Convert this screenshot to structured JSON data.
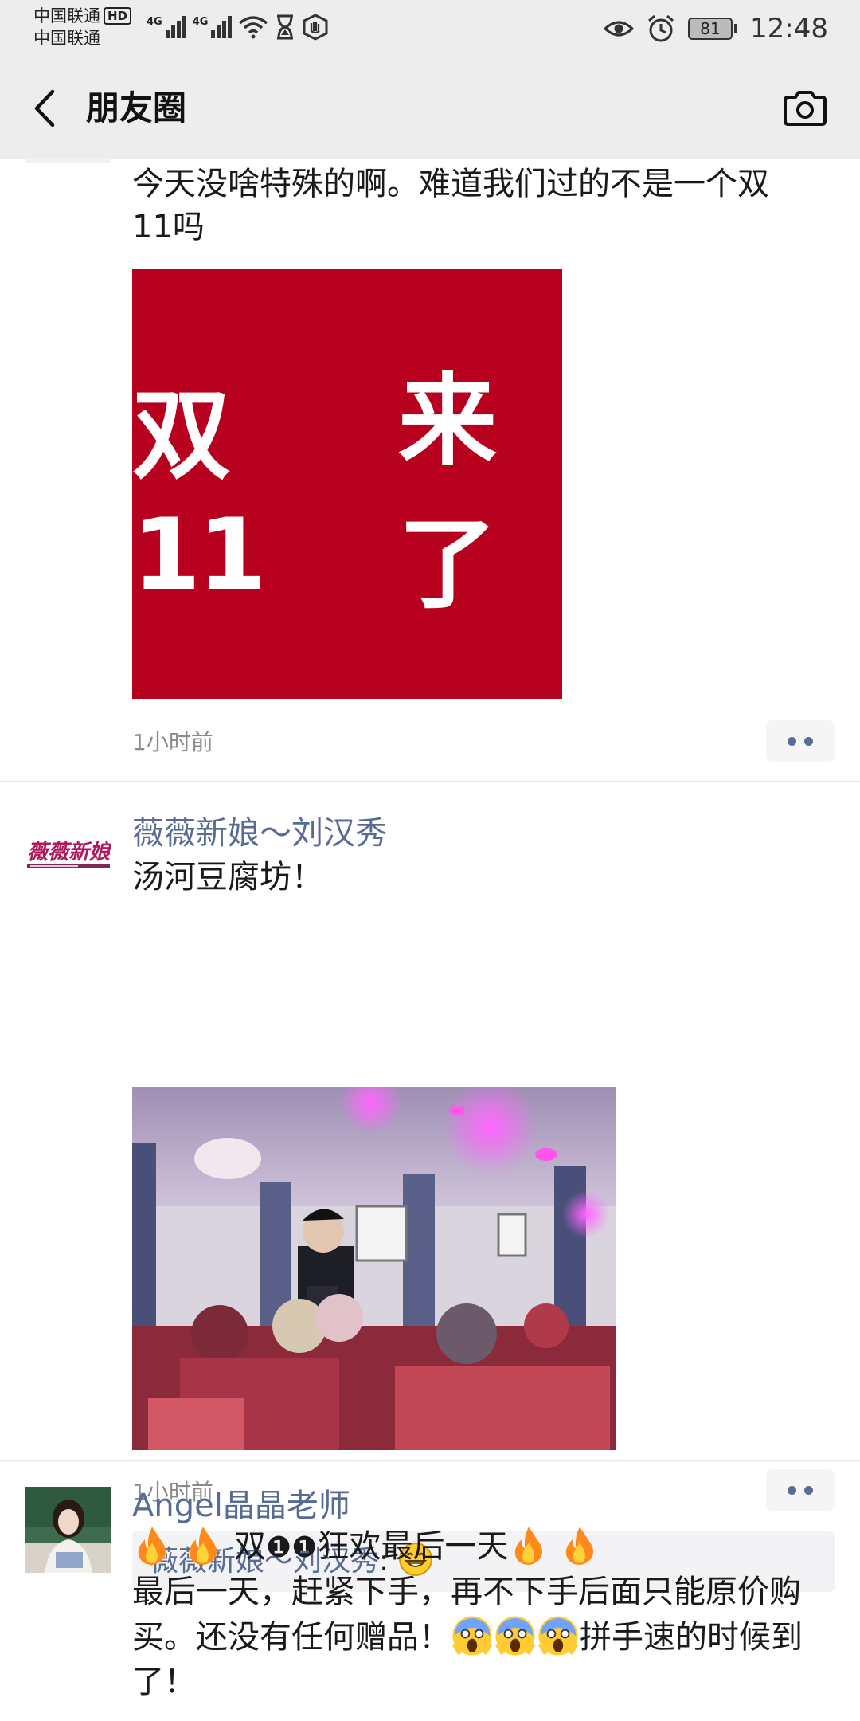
{
  "status_bar": {
    "carrier_line1": "中国联通",
    "carrier_hd": "HD",
    "carrier_line2": "中国联通",
    "network_1": "4G",
    "network_2": "4G",
    "battery": "81",
    "time": "12:48"
  },
  "nav": {
    "title": "朋友圈"
  },
  "posts": [
    {
      "text": "今天没啥特殊的啊。难道我们过的不是一个双11吗",
      "image_text_left": "双11",
      "image_text_right": "来了",
      "time": "1小时前"
    },
    {
      "author": "薇薇新娘～刘汉秀",
      "avatar_text": "薇薇新娘",
      "text": "汤河豆腐坊！",
      "time": "1小时前",
      "comment": {
        "author": "薇薇新娘～刘汉秀",
        "separator": ": "
      }
    },
    {
      "author": "Angel晶晶老师",
      "text_line1_a": "双",
      "text_line1_b": "❶❶",
      "text_line1_c": "狂欢最后一天",
      "text_line2": "最后一天，赶紧下手，再不下手后面只能原价购买。还没有任何赠品！",
      "text_line3": "拼手速的时候到了！"
    }
  ],
  "colors": {
    "link_blue": "#576b95",
    "red_banner": "#b8001f"
  },
  "icons": [
    "back-arrow-icon",
    "camera-icon",
    "more-dots-icon",
    "grin-emoji-icon",
    "fire-emoji-icon",
    "scream-emoji-icon"
  ]
}
